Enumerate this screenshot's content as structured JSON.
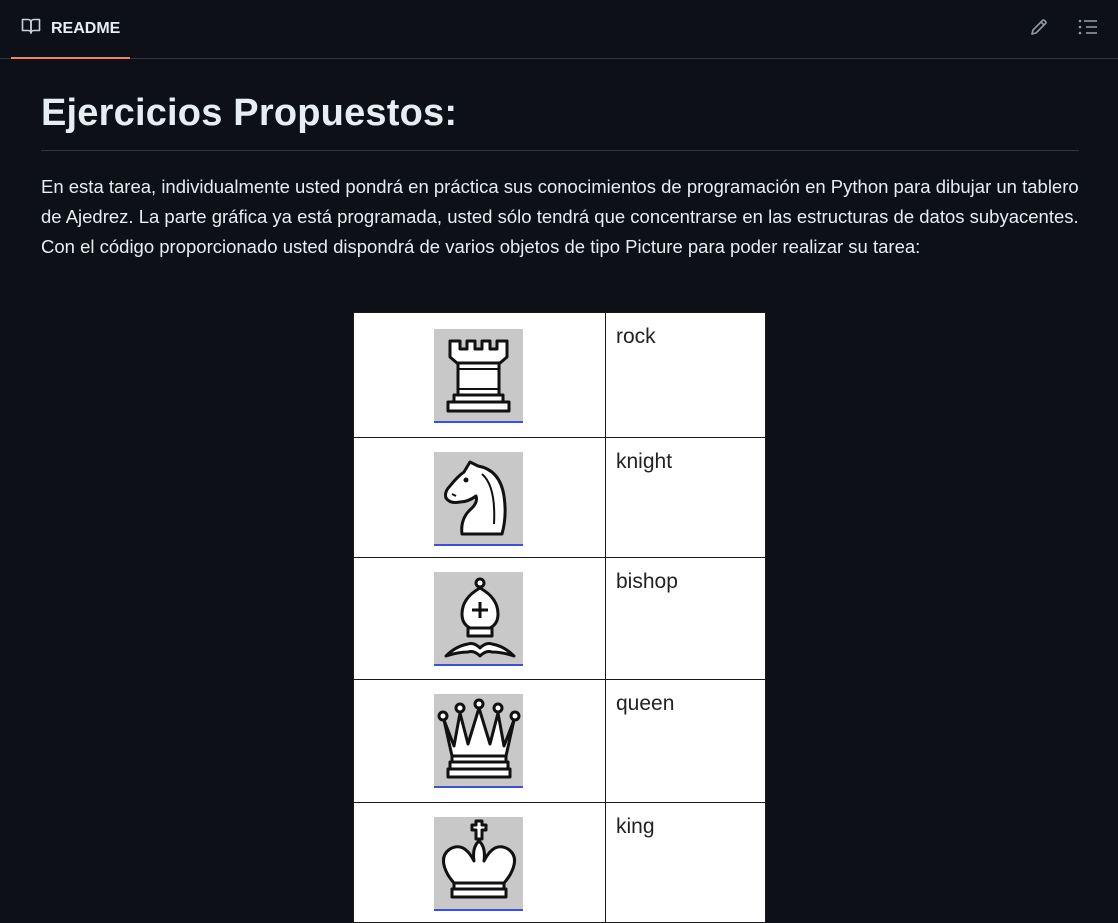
{
  "tab": {
    "label": "README",
    "icon": "book-icon"
  },
  "toolbar": {
    "edit_icon": "pencil-icon",
    "outline_icon": "list-icon"
  },
  "article": {
    "heading": "Ejercicios Propuestos:",
    "paragraph": "En esta tarea, individualmente usted pondrá en práctica sus conocimientos de programación en Python para dibujar un tablero de Ajedrez. La parte gráfica ya está programada, usted sólo tendrá que concentrarse en las estructuras de datos subyacentes. Con el código proporcionado usted dispondrá de varios objetos de tipo Picture para poder realizar su tarea:"
  },
  "pieces": [
    {
      "name": "rock",
      "icon": "rook-icon"
    },
    {
      "name": "knight",
      "icon": "knight-icon"
    },
    {
      "name": "bishop",
      "icon": "bishop-icon"
    },
    {
      "name": "queen",
      "icon": "queen-icon"
    },
    {
      "name": "king",
      "icon": "king-icon"
    }
  ],
  "colors": {
    "background": "#0d1117",
    "tab_underline": "#f78166",
    "border": "#30363d",
    "text": "#e6edf3"
  }
}
